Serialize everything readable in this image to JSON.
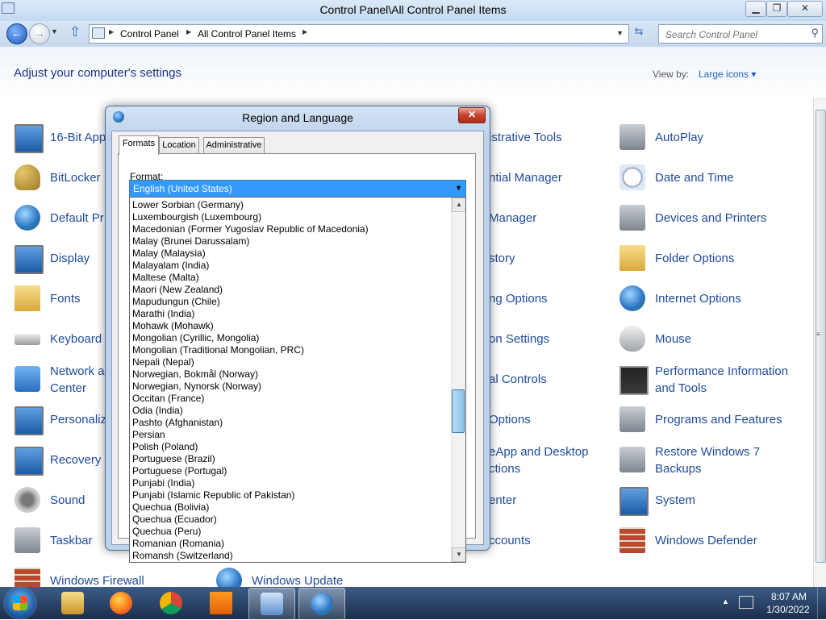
{
  "window": {
    "title": "Control Panel\\All Control Panel Items"
  },
  "address": {
    "crumbs": [
      "Control Panel",
      "All Control Panel Items"
    ],
    "search_placeholder": "Search Control Panel"
  },
  "header": {
    "title": "Adjust your computer's settings",
    "view_by_label": "View by:",
    "view_by_value": "Large icons"
  },
  "items": {
    "col1": [
      "16-Bit App",
      "BitLocker",
      "Default Pr",
      "Display",
      "Fonts",
      "Keyboard",
      "Network a\nCenter",
      "Personaliz",
      "Recovery",
      "Sound",
      "Taskbar",
      "Windows Firewall"
    ],
    "col2": [
      "Windows Update"
    ],
    "col3": [
      "istrative Tools",
      "ntial Manager",
      "Manager",
      "story",
      "ng Options",
      "on Settings",
      "al Controls",
      "Options",
      "eApp and Desktop\nctions",
      "enter",
      "ccounts"
    ],
    "col4": [
      "AutoPlay",
      "Date and Time",
      "Devices and Printers",
      "Folder Options",
      "Internet Options",
      "Mouse",
      "Performance Information\nand Tools",
      "Programs and Features",
      "Restore Windows 7\nBackups",
      "System",
      "Windows Defender"
    ]
  },
  "dialog": {
    "title": "Region and Language",
    "tabs": [
      "Formats",
      "Location",
      "Administrative"
    ],
    "format_label": "Format:",
    "format_value": "English (United States)",
    "options": [
      "Lower Sorbian (Germany)",
      "Luxembourgish (Luxembourg)",
      "Macedonian (Former Yugoslav Republic of Macedonia)",
      "Malay (Brunei Darussalam)",
      "Malay (Malaysia)",
      "Malayalam (India)",
      "Maltese (Malta)",
      "Maori (New Zealand)",
      "Mapudungun (Chile)",
      "Marathi (India)",
      "Mohawk (Mohawk)",
      "Mongolian (Cyrillic, Mongolia)",
      "Mongolian (Traditional Mongolian, PRC)",
      "Nepali (Nepal)",
      "Norwegian, Bokmål (Norway)",
      "Norwegian, Nynorsk (Norway)",
      "Occitan (France)",
      "Odia (India)",
      "Pashto (Afghanistan)",
      "Persian",
      "Polish (Poland)",
      "Portuguese (Brazil)",
      "Portuguese (Portugal)",
      "Punjabi (India)",
      "Punjabi (Islamic Republic of Pakistan)",
      "Quechua (Bolivia)",
      "Quechua (Ecuador)",
      "Quechua (Peru)",
      "Romanian (Romania)",
      "Romansh (Switzerland)"
    ]
  },
  "taskbar": {
    "time": "8:07 AM",
    "date": "1/30/2022"
  }
}
